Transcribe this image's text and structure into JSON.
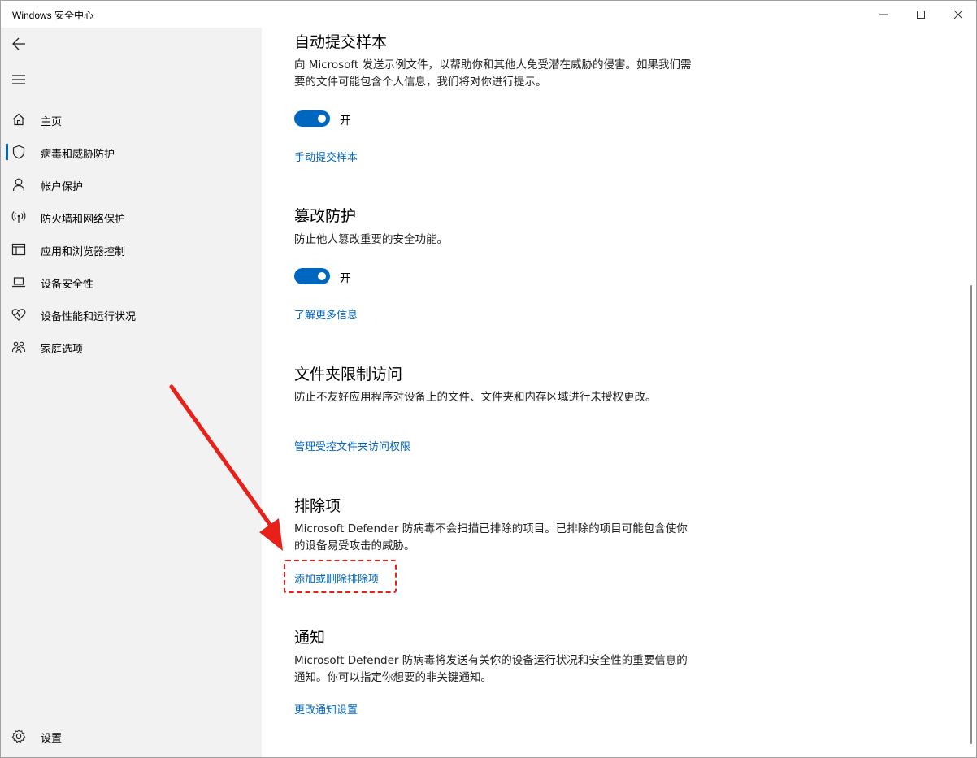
{
  "window": {
    "title": "Windows 安全中心"
  },
  "sidebar": {
    "items": [
      {
        "label": "主页",
        "icon": "home-icon"
      },
      {
        "label": "病毒和威胁防护",
        "icon": "shield-icon",
        "active": true
      },
      {
        "label": "帐户保护",
        "icon": "person-icon"
      },
      {
        "label": "防火墙和网络保护",
        "icon": "wifi-icon"
      },
      {
        "label": "应用和浏览器控制",
        "icon": "app-window-icon"
      },
      {
        "label": "设备安全性",
        "icon": "laptop-icon"
      },
      {
        "label": "设备性能和运行状况",
        "icon": "heart-pulse-icon"
      },
      {
        "label": "家庭选项",
        "icon": "family-icon"
      }
    ],
    "settings_label": "设置"
  },
  "sections": {
    "auto_submit": {
      "title": "自动提交样本",
      "desc": "向 Microsoft 发送示例文件，以帮助你和其他人免受潜在威胁的侵害。如果我们需要的文件可能包含个人信息，我们将对你进行提示。",
      "toggle_label": "开",
      "link": "手动提交样本"
    },
    "tamper": {
      "title": "篡改防护",
      "desc": "防止他人篡改重要的安全功能。",
      "toggle_label": "开",
      "link": "了解更多信息"
    },
    "folder_access": {
      "title": "文件夹限制访问",
      "desc": "防止不友好应用程序对设备上的文件、文件夹和内存区域进行未授权更改。",
      "link": "管理受控文件夹访问权限"
    },
    "exclusions": {
      "title": "排除项",
      "desc": "Microsoft Defender 防病毒不会扫描已排除的项目。已排除的项目可能包含使你的设备易受攻击的威胁。",
      "link": "添加或删除排除项"
    },
    "notifications": {
      "title": "通知",
      "desc": "Microsoft Defender 防病毒将发送有关你的设备运行状况和安全性的重要信息的通知。你可以指定你想要的非关键通知。",
      "link": "更改通知设置"
    }
  },
  "colors": {
    "accent": "#0067c0",
    "annotation": "#e8201a",
    "sidebar_bg": "#f2f2f2"
  }
}
